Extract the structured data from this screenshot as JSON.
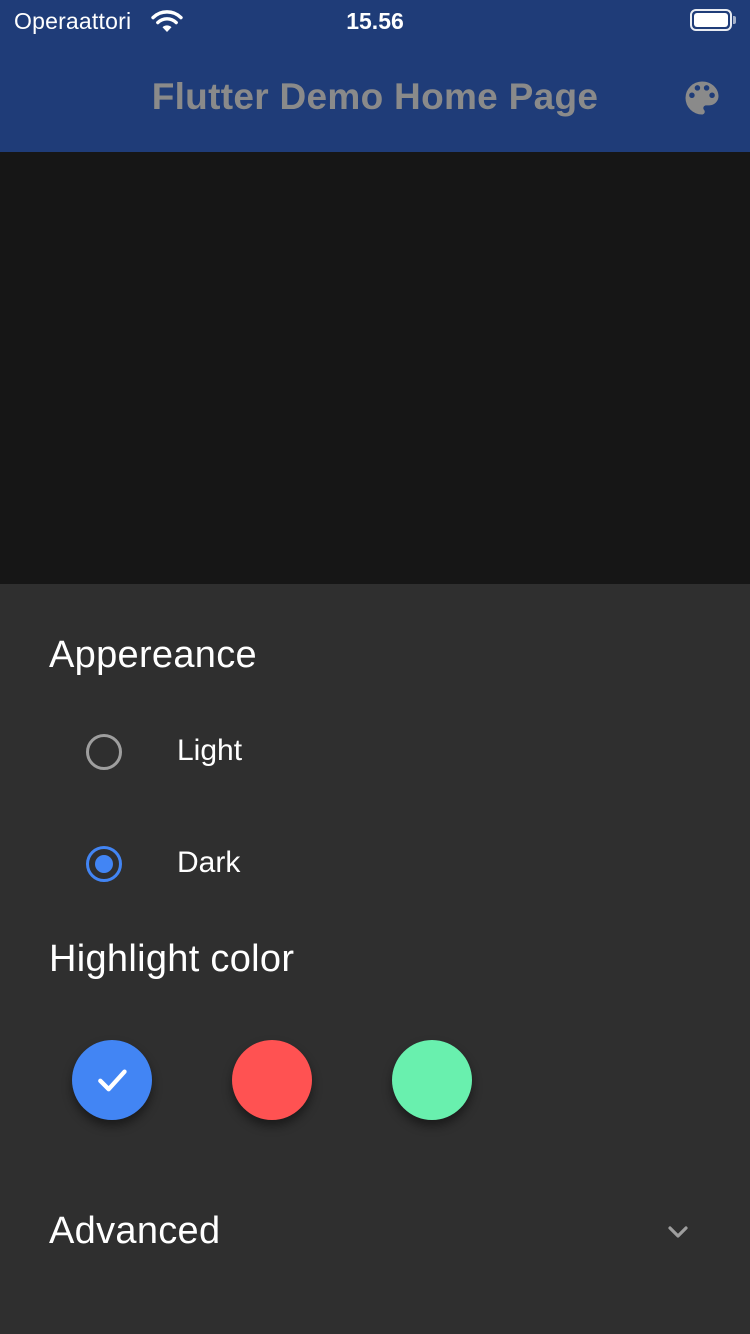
{
  "status_bar": {
    "carrier": "Operaattori",
    "time": "15.56",
    "wifi_icon": "wifi-icon",
    "battery_icon": "battery-full-icon"
  },
  "app_bar": {
    "title": "Flutter Demo Home Page",
    "action_icon": "palette-icon",
    "background_color": "#1f3c78",
    "title_color": "#8a8a8a"
  },
  "sheet": {
    "background_color": "#2f2f2f",
    "appearance": {
      "title": "Appereance",
      "options": [
        {
          "label": "Light",
          "selected": false
        },
        {
          "label": "Dark",
          "selected": true
        }
      ]
    },
    "highlight": {
      "title": "Highlight color",
      "colors": [
        {
          "name": "blue",
          "hex": "#4285f4",
          "selected": true
        },
        {
          "name": "red",
          "hex": "#ff5252",
          "selected": false
        },
        {
          "name": "green",
          "hex": "#69f0ae",
          "selected": false
        }
      ],
      "check_icon": "check-icon"
    },
    "advanced": {
      "title": "Advanced",
      "icon": "chevron-down-icon",
      "expanded": false
    }
  }
}
